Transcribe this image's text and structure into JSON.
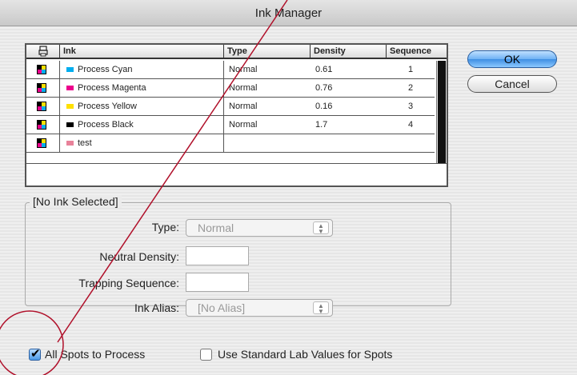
{
  "window": {
    "title": "Ink Manager"
  },
  "table": {
    "headers": {
      "icon": "",
      "ink": "Ink",
      "type": "Type",
      "density": "Density",
      "sequence": "Sequence"
    },
    "rows": [
      {
        "ink": "Process Cyan",
        "type": "Normal",
        "density": "0.61",
        "sequence": "1",
        "swatch": "#00aeef",
        "icon": "process-ink-icon"
      },
      {
        "ink": "Process Magenta",
        "type": "Normal",
        "density": "0.76",
        "sequence": "2",
        "swatch": "#ec008c",
        "icon": "process-ink-icon"
      },
      {
        "ink": "Process Yellow",
        "type": "Normal",
        "density": "0.16",
        "sequence": "3",
        "swatch": "#ffe000",
        "icon": "process-ink-icon"
      },
      {
        "ink": "Process Black",
        "type": "Normal",
        "density": "1.7",
        "sequence": "4",
        "swatch": "#000000",
        "icon": "process-ink-icon"
      },
      {
        "ink": "test",
        "type": "",
        "density": "",
        "sequence": "",
        "swatch": "#e8829a",
        "icon": "process-ink-icon"
      }
    ]
  },
  "buttons": {
    "ok": "OK",
    "cancel": "Cancel"
  },
  "details": {
    "group_title": "[No Ink Selected]",
    "type_label": "Type:",
    "type_value": "Normal",
    "neutral_density_label": "Neutral Density:",
    "neutral_density_value": "",
    "trapping_sequence_label": "Trapping Sequence:",
    "trapping_sequence_value": "",
    "ink_alias_label": "Ink Alias:",
    "ink_alias_value": "[No Alias]"
  },
  "options": {
    "all_spots_label": "All Spots to Process",
    "all_spots_checked": true,
    "lab_values_label": "Use Standard Lab Values for Spots",
    "lab_values_checked": false
  },
  "colors": {
    "annotation": "#b0102a",
    "accent": "#3f8fe3"
  }
}
